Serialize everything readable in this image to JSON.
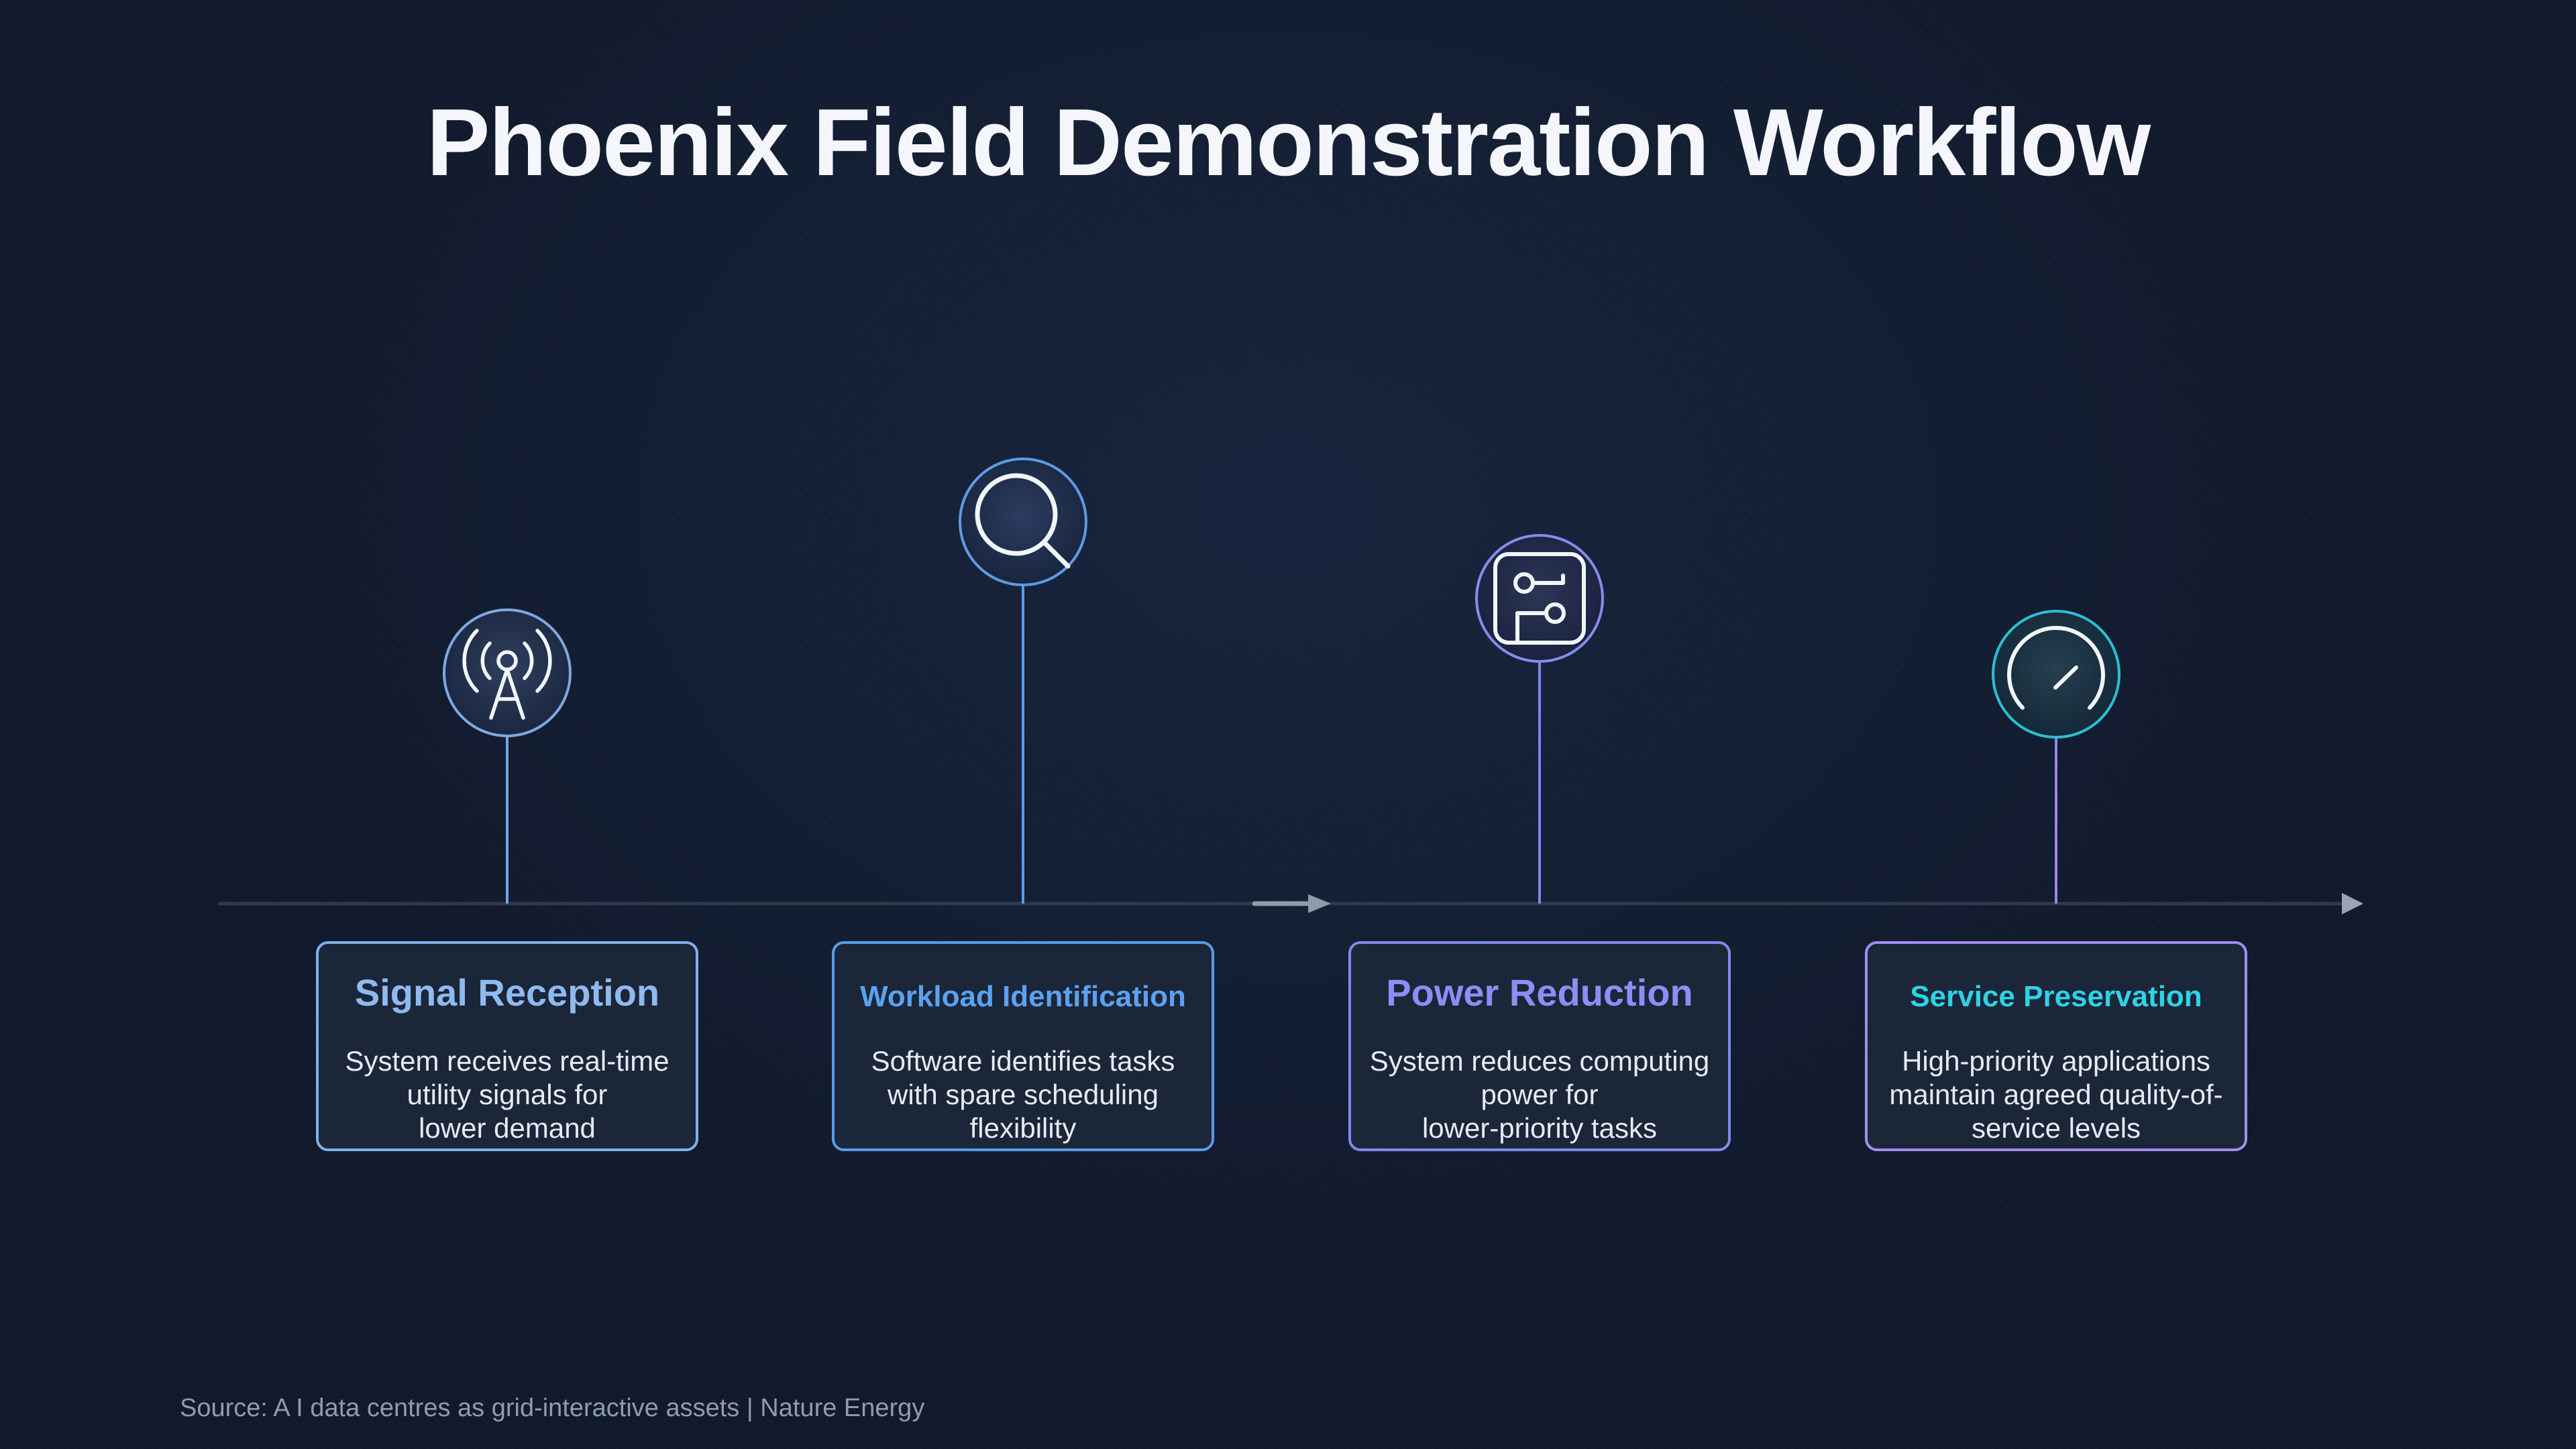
{
  "title": "Phoenix Field Demonstration Workflow",
  "steps": [
    {
      "title": "Signal Reception",
      "description_lines": [
        "System receives real-time",
        "utility signals for",
        "lower demand"
      ],
      "icon": "antenna-tower-icon",
      "color": "#8fbaf0"
    },
    {
      "title": "Workload Identification",
      "description_lines": [
        "Software identifies tasks",
        "with spare scheduling",
        "flexibility"
      ],
      "icon": "magnifier-icon",
      "color": "#5aa2f0"
    },
    {
      "title": "Power Reduction",
      "description_lines": [
        "System reduces computing",
        "power for",
        "lower-priority tasks"
      ],
      "icon": "circuit-path-icon",
      "color": "#8a8ff5"
    },
    {
      "title": "Service Preservation",
      "description_lines": [
        "High-priority applications",
        "maintain agreed quality-of-",
        "service levels"
      ],
      "icon": "gauge-icon",
      "color": "#2ed3e6"
    }
  ],
  "source": "Source: A I data centres as grid-interactive assets | Nature Energy"
}
